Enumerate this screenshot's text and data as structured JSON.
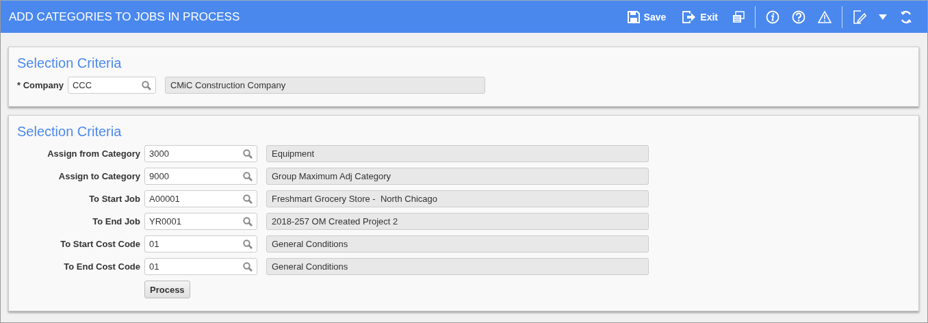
{
  "header": {
    "title": "ADD CATEGORIES TO JOBS IN PROCESS",
    "buttons": [
      {
        "label": "Save",
        "kind": "save"
      },
      {
        "label": "Exit",
        "kind": "exit"
      }
    ]
  },
  "panels": [
    {
      "title": "Selection Criteria",
      "fields": [
        {
          "label": "* Company",
          "value": "CCC",
          "description": "CMiC Construction Company"
        }
      ]
    },
    {
      "title": "Selection Criteria",
      "fields": [
        {
          "label": "Assign from Category",
          "value": "3000",
          "description": "Equipment"
        },
        {
          "label": "Assign to Category",
          "value": "9000",
          "description": "Group Maximum Adj Category"
        },
        {
          "label": "To Start Job",
          "value": "A00001",
          "description": "Freshmart Grocery Store -  North Chicago"
        },
        {
          "label": "To End Job",
          "value": "YR0001",
          "description": "2018-257 OM Created Project 2"
        },
        {
          "label": "To Start Cost Code",
          "value": "01",
          "description": "General Conditions"
        },
        {
          "label": "To End Cost Code",
          "value": "01",
          "description": "General Conditions"
        }
      ],
      "action": "Process"
    }
  ]
}
